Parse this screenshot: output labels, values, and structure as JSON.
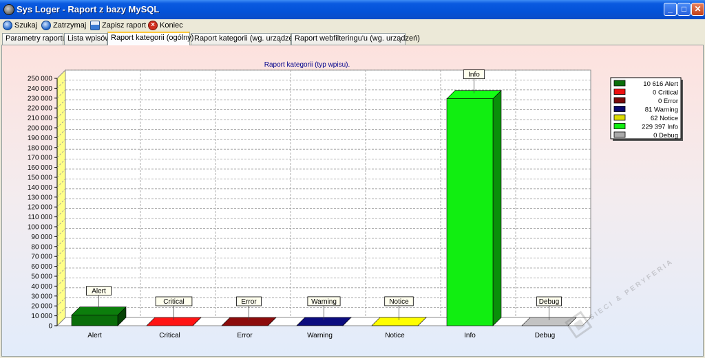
{
  "window": {
    "title": "Sys Loger - Raport z bazy MySQL"
  },
  "toolbar": [
    {
      "label": "Szukaj",
      "icon": "search-icon",
      "color": "#1e64c8"
    },
    {
      "label": "Zatrzymaj",
      "icon": "stop-icon",
      "color": "#1e64c8"
    },
    {
      "label": "Zapisz raport",
      "icon": "save-icon",
      "color": "#3a7bd5"
    },
    {
      "label": "Koniec",
      "icon": "close-icon",
      "color": "#d03020"
    }
  ],
  "tabs": [
    {
      "label": "Parametry raportu",
      "active": false
    },
    {
      "label": "Lista wpisów",
      "active": false
    },
    {
      "label": "Raport kategorii (ogólny)",
      "active": true
    },
    {
      "label": "Raport kategorii (wg. urządzeń)",
      "active": false
    },
    {
      "label": "Raport webfilteringu'u (wg. urządzeń)",
      "active": false
    }
  ],
  "chart_data": {
    "type": "bar",
    "title": "Raport kategorii (typ wpisu).",
    "categories": [
      "Alert",
      "Critical",
      "Error",
      "Warning",
      "Notice",
      "Info",
      "Debug"
    ],
    "values": [
      10616,
      0,
      0,
      81,
      62,
      229397,
      0
    ],
    "colors": [
      "#0a6e0a",
      "#ee1111",
      "#7a0a0a",
      "#0a0a6e",
      "#dddd00",
      "#11ee11",
      "#aaaaaa"
    ],
    "ylim": [
      0,
      250000
    ],
    "yticks": [
      "0",
      "10 000",
      "20 000",
      "30 000",
      "40 000",
      "50 000",
      "60 000",
      "70 000",
      "80 000",
      "90 000",
      "100 000",
      "110 000",
      "120 000",
      "130 000",
      "140 000",
      "150 000",
      "160 000",
      "170 000",
      "180 000",
      "190 000",
      "200 000",
      "210 000",
      "220 000",
      "230 000",
      "240 000",
      "250 000"
    ],
    "legend": [
      "10 616 Alert",
      "0 Critical",
      "0 Error",
      "81 Warning",
      "62 Notice",
      "229 397 Info",
      "0 Debug"
    ],
    "legend_position": "top-right",
    "grid": true,
    "xlabel": "",
    "ylabel": ""
  },
  "watermark": {
    "text": "SIECI & PERYFERIA"
  }
}
